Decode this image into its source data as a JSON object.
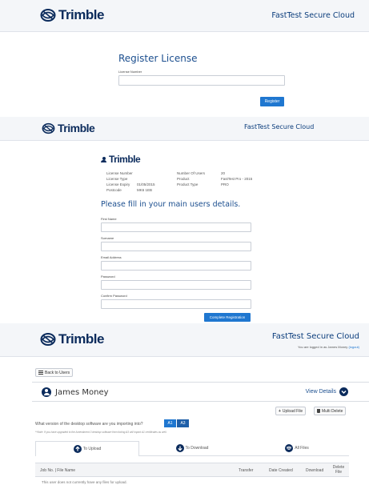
{
  "panel1": {
    "brand": "Trimble",
    "app_title": "FastTest Secure Cloud",
    "heading": "Register License",
    "license_label": "License Number",
    "license_value": "",
    "register_button": "Register"
  },
  "panel2": {
    "brand": "Trimble",
    "app_title": "FastTest Secure Cloud",
    "card_brand": "Trimble",
    "info": {
      "license_number_label": "License Number",
      "license_type_label": "License Type",
      "license_expiry_label": "License Expiry",
      "license_expiry_value": "01/05/2015",
      "postcode_label": "Postcode",
      "postcode_value": "MK6 1EB",
      "num_users_label": "Number Of Users",
      "num_users_value": "20",
      "product_label": "Product",
      "product_value": "FastTest Pro - 2015",
      "product_type_label": "Product Type",
      "product_type_value": "PRO"
    },
    "heading": "Please fill in your main users details.",
    "fields": {
      "first_name": "First Name",
      "surname": "Surname",
      "email": "Email Address",
      "password": "Password",
      "confirm_password": "Confirm Password"
    },
    "complete_button": "Complete Registration"
  },
  "panel3": {
    "brand": "Trimble",
    "app_title": "FastTest Secure Cloud",
    "logged_in_text": "You are logged in as James Money",
    "logout_link": "(logout)",
    "back_button": "Back to Users",
    "user_name": "James Money",
    "view_details": "View Details",
    "upload_file": "Upload File",
    "multi_delete": "Multi Delete",
    "version_question": "What version of the desktop software are you importing into?",
    "version_options": [
      "A1",
      "A3"
    ],
    "version_note": "**Note: If you have upgraded to the Amendment 3 desktop software then ticking A3 will import A1 certificates as well.",
    "tabs": [
      "To Upload",
      "To Download",
      "All Files"
    ],
    "table_headers": [
      "Job No. | File Name",
      "Transfer",
      "Date Created",
      "Download",
      "Delete File"
    ],
    "empty_text": "This user does not currently have any files for upload."
  },
  "colors": {
    "brand_navy": "#0b2b5c",
    "accent_blue": "#1f77d0",
    "header_bg": "#f4f6f9"
  }
}
